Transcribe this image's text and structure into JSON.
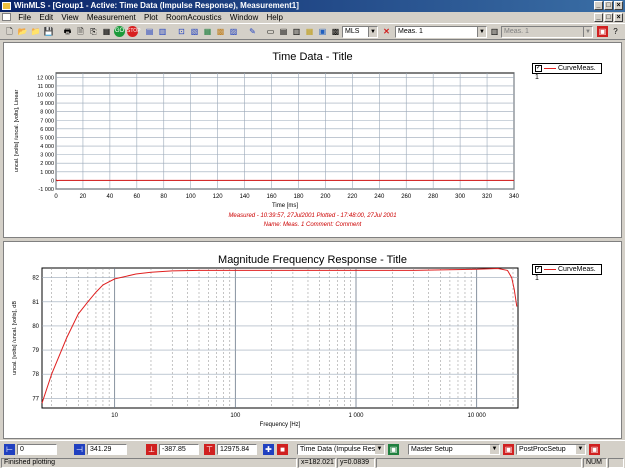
{
  "window": {
    "title": "WinMLS - [Group1 - Active: Time Data (Impulse Response), Measurement1]"
  },
  "menu": [
    "File",
    "Edit",
    "View",
    "Measurement",
    "Plot",
    "RoomAcoustics",
    "Window",
    "Help"
  ],
  "toolbar": {
    "method_value": "MLS",
    "meas_value": "Meas. 1",
    "meas2_value": "Meas. 1"
  },
  "time_chart": {
    "title": "Time Data - Title",
    "xlabel": "Time [ms]",
    "ylabel": "uncal. [volts] /uncal. [volts], Linear",
    "yticks": [
      "12 000",
      "11 000",
      "10 000",
      "9 000",
      "8 000",
      "7 000",
      "6 000",
      "5 000",
      "4 000",
      "3 000",
      "2 000",
      "1 000",
      "0",
      "-1 000"
    ],
    "xticks": [
      "0",
      "20",
      "40",
      "60",
      "80",
      "100",
      "120",
      "140",
      "160",
      "180",
      "200",
      "220",
      "240",
      "260",
      "280",
      "300",
      "320",
      "340"
    ],
    "legend": "CurveMeas. 1",
    "info_line1": "Measured - 10:39:57, 27Jul2001          Plotted - 17:48:00, 27Jul 2001",
    "info_line2": "Name: Meas. 1       Comment: Comment"
  },
  "freq_chart": {
    "title": "Magnitude Frequency Response - Title",
    "xlabel": "Frequency [Hz]",
    "ylabel": "uncal. [volts] /uncal. [volts], dB",
    "yticks": [
      "82",
      "81",
      "80",
      "79",
      "78",
      "77"
    ],
    "xticks": [
      "10",
      "100",
      "1 000",
      "10 000"
    ],
    "legend": "CurveMeas. 1"
  },
  "chart_data": [
    {
      "type": "line",
      "title": "Time Data - Title",
      "xlabel": "Time [ms]",
      "ylabel": "uncal. [volts] /uncal. [volts], Linear",
      "xlim": [
        0,
        340
      ],
      "ylim": [
        -1000,
        12500
      ],
      "grid": true,
      "legend_position": "top-right",
      "series": [
        {
          "name": "CurveMeas. 1",
          "x": [
            0,
            0.3,
            1,
            2,
            340
          ],
          "y": [
            0,
            50,
            -30,
            0,
            0
          ]
        }
      ]
    },
    {
      "type": "line",
      "title": "Magnitude Frequency Response - Title",
      "xlabel": "Frequency [Hz]",
      "ylabel": "uncal. [volts] /uncal. [volts], dB",
      "xscale": "log",
      "xlim": [
        2.5,
        22000
      ],
      "ylim": [
        76.6,
        82.4
      ],
      "grid": true,
      "legend_position": "top-right",
      "series": [
        {
          "name": "CurveMeas. 1",
          "x": [
            2.5,
            3,
            4,
            5,
            6,
            7,
            8,
            10,
            15,
            20,
            30,
            50,
            100,
            300,
            1000,
            3000,
            10000,
            15000,
            18000,
            19500,
            20500,
            21500
          ],
          "y": [
            76.8,
            78.0,
            79.5,
            80.5,
            81.0,
            81.4,
            81.7,
            81.95,
            82.15,
            82.22,
            82.28,
            82.3,
            82.3,
            82.3,
            82.3,
            82.3,
            82.35,
            82.38,
            82.3,
            82.0,
            81.5,
            80.8
          ]
        }
      ]
    }
  ],
  "statusrow": {
    "field1": "0",
    "field2": "341.29",
    "field3": "-387.85",
    "field4": "12975.84",
    "plot_select": "Time Data (Impulse Resp",
    "setup_select": "Master Setup",
    "postproc_select": "PostProcSetup"
  },
  "statusbar": {
    "message": "Finished plotting",
    "x_readout": "x=182.021",
    "y_readout": "y=0.0839",
    "num": "NUM"
  },
  "colors": {
    "curve": "#e02020",
    "titlebar": "#0a246a",
    "info_text": "#cc0000"
  }
}
